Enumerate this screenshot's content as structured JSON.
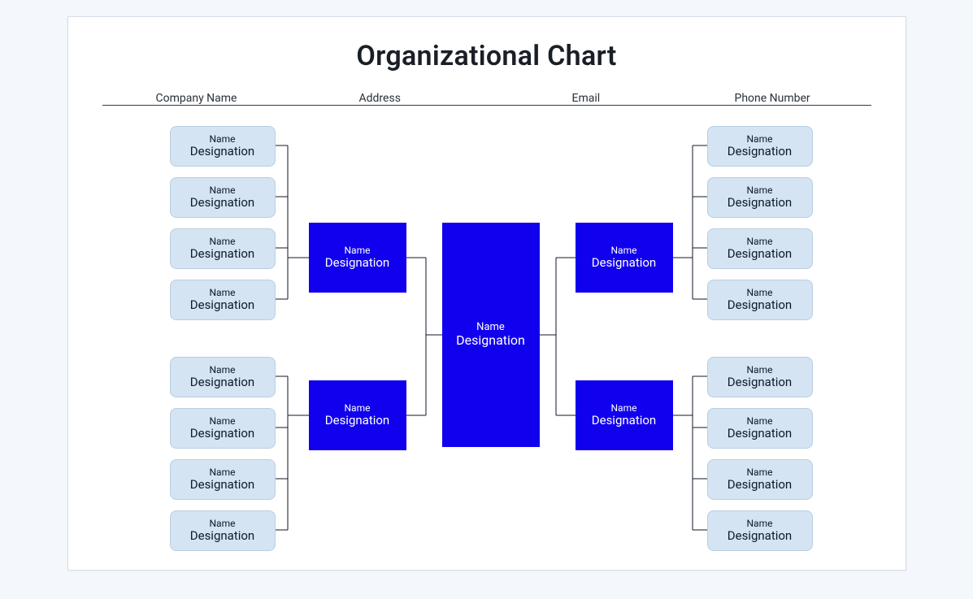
{
  "title": "Organizational Chart",
  "headers": {
    "company": "Company Name",
    "address": "Address",
    "email": "Email",
    "phone": "Phone Number"
  },
  "label": {
    "name": "Name",
    "designation": "Designation"
  },
  "root": {
    "name": "Name",
    "designation": "Designation"
  },
  "managers": {
    "left_top": {
      "name": "Name",
      "designation": "Designation"
    },
    "left_bottom": {
      "name": "Name",
      "designation": "Designation"
    },
    "right_top": {
      "name": "Name",
      "designation": "Designation"
    },
    "right_bottom": {
      "name": "Name",
      "designation": "Designation"
    }
  },
  "leaves": {
    "left_top": [
      {
        "name": "Name",
        "designation": "Designation"
      },
      {
        "name": "Name",
        "designation": "Designation"
      },
      {
        "name": "Name",
        "designation": "Designation"
      },
      {
        "name": "Name",
        "designation": "Designation"
      }
    ],
    "left_bottom": [
      {
        "name": "Name",
        "designation": "Designation"
      },
      {
        "name": "Name",
        "designation": "Designation"
      },
      {
        "name": "Name",
        "designation": "Designation"
      },
      {
        "name": "Name",
        "designation": "Designation"
      }
    ],
    "right_top": [
      {
        "name": "Name",
        "designation": "Designation"
      },
      {
        "name": "Name",
        "designation": "Designation"
      },
      {
        "name": "Name",
        "designation": "Designation"
      },
      {
        "name": "Name",
        "designation": "Designation"
      }
    ],
    "right_bottom": [
      {
        "name": "Name",
        "designation": "Designation"
      },
      {
        "name": "Name",
        "designation": "Designation"
      },
      {
        "name": "Name",
        "designation": "Designation"
      },
      {
        "name": "Name",
        "designation": "Designation"
      }
    ]
  },
  "chart_data": {
    "type": "org-tree",
    "root": {
      "name": "Name",
      "designation": "Designation"
    },
    "branches": [
      {
        "side": "left",
        "manager": {
          "name": "Name",
          "designation": "Designation"
        },
        "reports": [
          {
            "name": "Name",
            "designation": "Designation"
          },
          {
            "name": "Name",
            "designation": "Designation"
          },
          {
            "name": "Name",
            "designation": "Designation"
          },
          {
            "name": "Name",
            "designation": "Designation"
          }
        ]
      },
      {
        "side": "left",
        "manager": {
          "name": "Name",
          "designation": "Designation"
        },
        "reports": [
          {
            "name": "Name",
            "designation": "Designation"
          },
          {
            "name": "Name",
            "designation": "Designation"
          },
          {
            "name": "Name",
            "designation": "Designation"
          },
          {
            "name": "Name",
            "designation": "Designation"
          }
        ]
      },
      {
        "side": "right",
        "manager": {
          "name": "Name",
          "designation": "Designation"
        },
        "reports": [
          {
            "name": "Name",
            "designation": "Designation"
          },
          {
            "name": "Name",
            "designation": "Designation"
          },
          {
            "name": "Name",
            "designation": "Designation"
          },
          {
            "name": "Name",
            "designation": "Designation"
          }
        ]
      },
      {
        "side": "right",
        "manager": {
          "name": "Name",
          "designation": "Designation"
        },
        "reports": [
          {
            "name": "Name",
            "designation": "Designation"
          },
          {
            "name": "Name",
            "designation": "Designation"
          },
          {
            "name": "Name",
            "designation": "Designation"
          },
          {
            "name": "Name",
            "designation": "Designation"
          }
        ]
      }
    ]
  }
}
